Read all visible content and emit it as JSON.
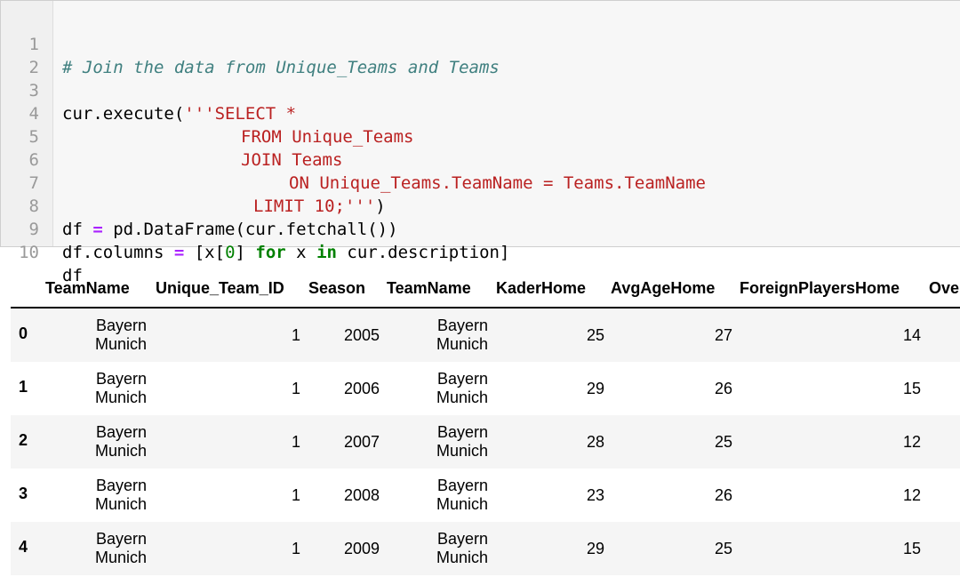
{
  "code_cell": {
    "line_numbers": [
      "1",
      "2",
      "3",
      "4",
      "5",
      "6",
      "7",
      "8",
      "9",
      "10"
    ],
    "lines": {
      "l1_comment": "# Join the data from Unique_Teams and Teams",
      "l3_call": "cur.execute(",
      "l3_str": "'''SELECT *",
      "l4_str": "FROM Unique_Teams",
      "l5_str": "JOIN Teams",
      "l6_str": "ON Unique_Teams.TeamName = Teams.TeamName",
      "l7_str": "LIMIT 10;'''",
      "l7_close": ")",
      "l8_a": "df ",
      "l8_eq": "=",
      "l8_b": " pd.DataFrame(cur.fetchall())",
      "l9_a": "df.columns ",
      "l9_eq": "=",
      "l9_b": " [x[",
      "l9_zero": "0",
      "l9_c": "] ",
      "l9_for": "for",
      "l9_d": " x ",
      "l9_in": "in",
      "l9_e": " cur.description]",
      "l10": "df"
    }
  },
  "dataframe": {
    "columns": [
      "TeamName",
      "Unique_Team_ID",
      "Season",
      "TeamName",
      "KaderHome",
      "AvgAgeHome",
      "ForeignPlayersHome",
      "Ove"
    ],
    "rows": [
      {
        "index": "0",
        "team_a": [
          "Bayern",
          "Munich"
        ],
        "unique_team_id": "1",
        "season": "2005",
        "team_b": [
          "Bayern",
          "Munich"
        ],
        "kader_home": "25",
        "avg_age_home": "27",
        "foreign_players_home": "14"
      },
      {
        "index": "1",
        "team_a": [
          "Bayern",
          "Munich"
        ],
        "unique_team_id": "1",
        "season": "2006",
        "team_b": [
          "Bayern",
          "Munich"
        ],
        "kader_home": "29",
        "avg_age_home": "26",
        "foreign_players_home": "15"
      },
      {
        "index": "2",
        "team_a": [
          "Bayern",
          "Munich"
        ],
        "unique_team_id": "1",
        "season": "2007",
        "team_b": [
          "Bayern",
          "Munich"
        ],
        "kader_home": "28",
        "avg_age_home": "25",
        "foreign_players_home": "12"
      },
      {
        "index": "3",
        "team_a": [
          "Bayern",
          "Munich"
        ],
        "unique_team_id": "1",
        "season": "2008",
        "team_b": [
          "Bayern",
          "Munich"
        ],
        "kader_home": "23",
        "avg_age_home": "26",
        "foreign_players_home": "12"
      },
      {
        "index": "4",
        "team_a": [
          "Bayern",
          "Munich"
        ],
        "unique_team_id": "1",
        "season": "2009",
        "team_b": [
          "Bayern",
          "Munich"
        ],
        "kader_home": "29",
        "avg_age_home": "25",
        "foreign_players_home": "15"
      }
    ]
  },
  "colors": {
    "comment": "#408080",
    "string": "#ba2121",
    "operator": "#aa22ff",
    "keyword": "#008000",
    "number": "#008000",
    "cell_background": "#f7f7f7",
    "row_stripe": "#f5f5f5"
  }
}
